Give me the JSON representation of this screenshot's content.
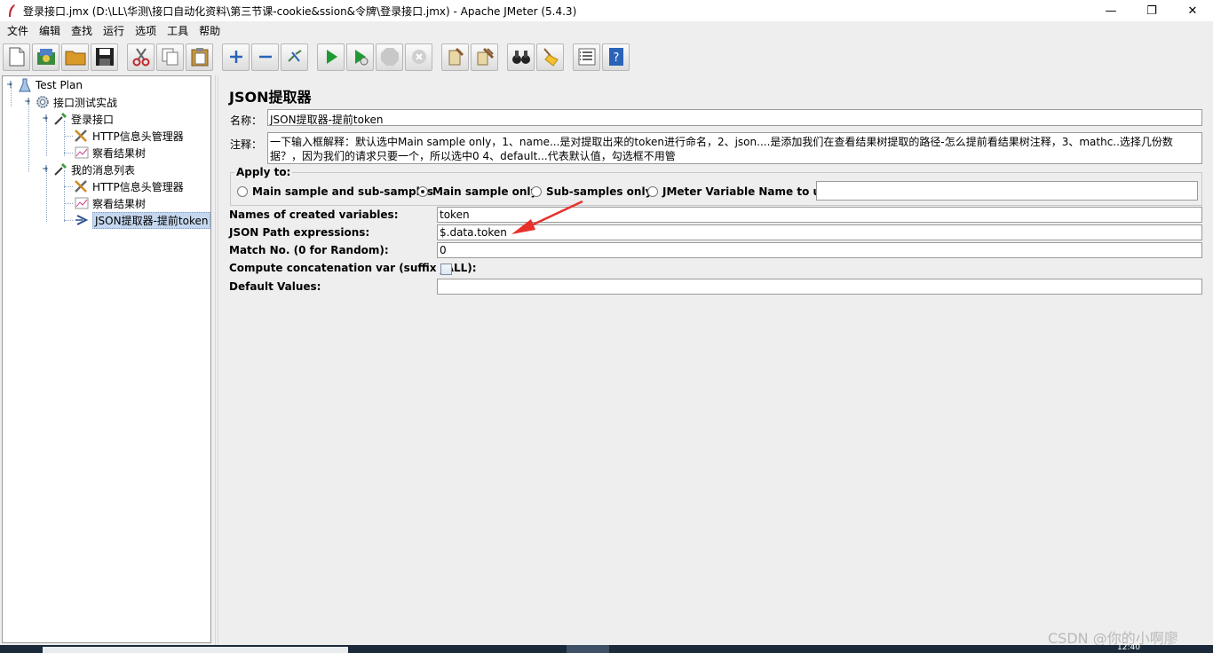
{
  "window": {
    "title": "登录接口.jmx (D:\\LL\\华测\\接口自动化资料\\第三节课-cookie&ssion&令牌\\登录接口.jmx) - Apache JMeter (5.4.3)",
    "minimize": "—",
    "maximize": "❐",
    "close": "✕"
  },
  "menu": [
    "文件",
    "编辑",
    "查找",
    "运行",
    "选项",
    "工具",
    "帮助"
  ],
  "toolbar": [
    {
      "name": "new-icon",
      "glyph": "new"
    },
    {
      "name": "templates-icon",
      "glyph": "templates"
    },
    {
      "name": "open-icon",
      "glyph": "open"
    },
    {
      "name": "save-icon",
      "glyph": "save"
    },
    {
      "name": "cut-icon",
      "glyph": "cut"
    },
    {
      "name": "copy-icon",
      "glyph": "copy"
    },
    {
      "name": "paste-icon",
      "glyph": "paste"
    },
    {
      "name": "expand-icon",
      "glyph": "+"
    },
    {
      "name": "collapse-icon",
      "glyph": "−"
    },
    {
      "name": "toggle-icon",
      "glyph": "toggle"
    },
    {
      "name": "start-icon",
      "glyph": "start"
    },
    {
      "name": "start-no-pauses-icon",
      "glyph": "start-np"
    },
    {
      "name": "stop-icon",
      "glyph": "stop"
    },
    {
      "name": "shutdown-icon",
      "glyph": "shutdown"
    },
    {
      "name": "clear-icon",
      "glyph": "clear"
    },
    {
      "name": "clear-all-icon",
      "glyph": "clear-all"
    },
    {
      "name": "search-icon",
      "glyph": "search"
    },
    {
      "name": "reset-search-icon",
      "glyph": "broom"
    },
    {
      "name": "function-helper-icon",
      "glyph": "list"
    },
    {
      "name": "help-icon",
      "glyph": "?"
    }
  ],
  "tree": {
    "test_plan": "Test Plan",
    "thread_group": "接口测试实战",
    "sampler1": "登录接口",
    "header_mgr1": "HTTP信息头管理器",
    "results_tree1": "察看结果树",
    "sampler2": "我的消息列表",
    "header_mgr2": "HTTP信息头管理器",
    "results_tree2": "察看结果树",
    "extractor": "JSON提取器-提前token"
  },
  "panel": {
    "title": "JSON提取器",
    "name_label": "名称：",
    "name_value": "JSON提取器-提前token",
    "comment_label": "注释：",
    "comment_value": "一下输入框解释：默认选中Main sample only，1、name...是对提取出来的token进行命名，2、json....是添加我们在查看结果树提取的路径-怎么提前看结果树注释，3、mathc..选择几份数据？，因为我们的请求只要一个，所以选中0  4、default...代表默认值，勾选框不用管",
    "apply_to": "Apply to:",
    "radio_main_sub": "Main sample and sub-samples",
    "radio_main_only": "Main sample only",
    "radio_sub_only": "Sub-samples only",
    "radio_var": "JMeter Variable Name to use",
    "var_value": "",
    "names_label": "Names of created variables:",
    "names_value": "token",
    "path_label": "JSON Path expressions:",
    "path_value": "$.data.token",
    "match_label": "Match No. (0 for Random):",
    "match_value": "0",
    "concat_label": "Compute concatenation var (suffix _ALL):",
    "default_label": "Default Values:",
    "default_value": ""
  },
  "watermark": "CSDN @你的小啊廖",
  "taskbar_clock": "12:40",
  "colors": {
    "arrow": "#e8312a",
    "selection": "#c4d7ef"
  }
}
